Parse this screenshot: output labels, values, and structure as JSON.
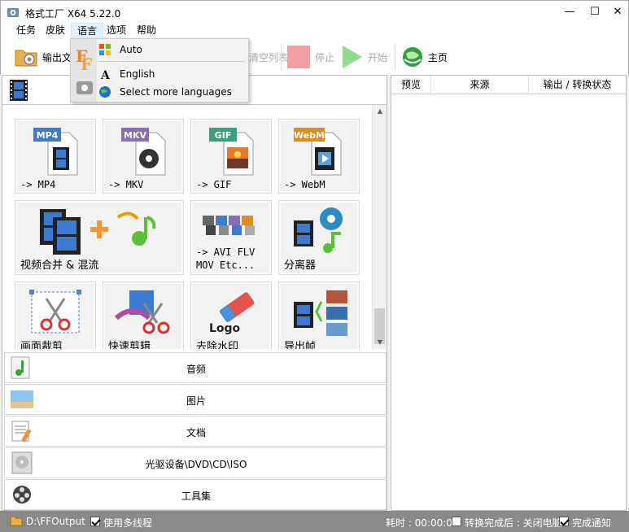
{
  "window": {
    "title": "格式工厂 X64 5.22.0",
    "min": "—",
    "max": "☐",
    "close": "✕"
  },
  "menu": [
    {
      "label": "任务"
    },
    {
      "label": "皮肤"
    },
    {
      "label": "语言"
    },
    {
      "label": "选项"
    },
    {
      "label": "帮助"
    }
  ],
  "toolbar": {
    "output_folder": "输出文件夹",
    "clear_list": "清空列表",
    "stop": "停止",
    "start": "开始",
    "home": "主页"
  },
  "language_menu": {
    "items": [
      {
        "label": "Auto",
        "icon": "windows-icon"
      },
      {
        "label": "English",
        "icon": "letter-a-icon"
      },
      {
        "label": "Select more languages",
        "icon": "globe-icon"
      }
    ]
  },
  "video_tiles": [
    {
      "badge": "MP4",
      "label": "-> MP4",
      "badge_color": "#3e7bc8"
    },
    {
      "badge": "MKV",
      "label": "-> MKV",
      "badge_color": "#8b6db5"
    },
    {
      "badge": "GIF",
      "label": "-> GIF",
      "badge_color": "#3aa17c"
    },
    {
      "badge": "WebM",
      "label": "-> WebM",
      "badge_color": "#e08a1a"
    },
    {
      "label": "视频合并 & 混流"
    },
    {
      "label": "-> AVI FLV\nMOV Etc..."
    },
    {
      "label": "分离器"
    },
    {
      "label": "画面裁剪"
    },
    {
      "label": "快速剪辑"
    },
    {
      "label": "去除水印",
      "logo_text": "Logo"
    },
    {
      "label": "导出帧"
    }
  ],
  "categories": [
    {
      "label": "音频",
      "icon": "music-note-icon"
    },
    {
      "label": "图片",
      "icon": "picture-icon"
    },
    {
      "label": "文档",
      "icon": "document-icon"
    },
    {
      "label": "光驱设备\\DVD\\CD\\ISO",
      "icon": "disc-drive-icon"
    },
    {
      "label": "工具集",
      "icon": "toolbox-icon"
    }
  ],
  "task_list": {
    "columns": [
      "预览",
      "来源",
      "输出 / 转换状态"
    ]
  },
  "status": {
    "output_path": "D:\\FFOutput",
    "multithread_label": "使用多线程",
    "multithread_checked": true,
    "elapsed": "耗时 : 00:00:00",
    "after_done_label": "转换完成后 : 关闭电脑",
    "after_done_checked": false,
    "notify_label": "完成通知",
    "notify_checked": true
  },
  "colors": {
    "accent_red": "#f08080",
    "accent_green": "#7ed37e",
    "statusbar": "#8a8a8a"
  }
}
